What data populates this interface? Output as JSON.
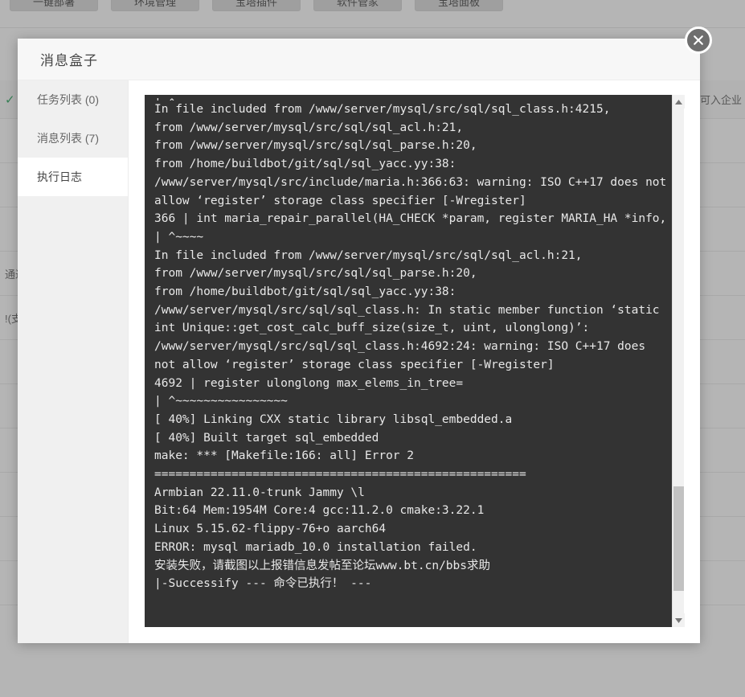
{
  "background": {
    "toolbar_buttons": [
      {
        "label": "一键部署"
      },
      {
        "label": "环境管理"
      },
      {
        "label": "宝塔插件"
      },
      {
        "label": "软件管家"
      },
      {
        "label": "宝塔面板"
      }
    ],
    "table_rows": [
      {
        "left": "✓",
        "right": "可入企业"
      },
      {
        "left": "",
        "right": ""
      },
      {
        "left": "",
        "right": ""
      },
      {
        "left": "",
        "right": ""
      },
      {
        "left": "通过",
        "right": ""
      },
      {
        "left": "!(支",
        "right": ""
      },
      {
        "left": "",
        "right": ""
      },
      {
        "left": "",
        "right": ""
      },
      {
        "left": "",
        "right": ""
      },
      {
        "left": "",
        "right": ""
      },
      {
        "left": "",
        "right": ""
      },
      {
        "left": "",
        "right": ""
      }
    ]
  },
  "modal": {
    "title": "消息盒子",
    "close_icon": "close-icon",
    "tabs": [
      {
        "label": "任务列表 (0)",
        "active": false
      },
      {
        "label": "消息列表 (7)",
        "active": false
      },
      {
        "label": "执行日志",
        "active": true
      }
    ],
    "log": {
      "clipped_top_line": "| ^~~~~~~~~~~~~~~~~~~",
      "lines": [
        "In file included from /www/server/mysql/src/sql/sql_class.h:4215,",
        "from /www/server/mysql/src/sql/sql_acl.h:21,",
        "from /www/server/mysql/src/sql/sql_parse.h:20,",
        "from /home/buildbot/git/sql/sql_yacc.yy:38:",
        "/www/server/mysql/src/include/maria.h:366:63: warning: ISO C++17 does not allow ‘register’ storage class specifier [-Wregister]",
        "366 | int maria_repair_parallel(HA_CHECK *param, register MARIA_HA *info,",
        "| ^~~~~",
        "In file included from /www/server/mysql/src/sql/sql_acl.h:21,",
        "from /www/server/mysql/src/sql/sql_parse.h:20,",
        "from /home/buildbot/git/sql/sql_yacc.yy:38:",
        "/www/server/mysql/src/sql/sql_class.h: In static member function ‘static int Unique::get_cost_calc_buff_size(size_t, uint, ulonglong)’:",
        "/www/server/mysql/src/sql/sql_class.h:4692:24: warning: ISO C++17 does not allow ‘register’ storage class specifier [-Wregister]",
        "4692 | register ulonglong max_elems_in_tree=",
        "| ^~~~~~~~~~~~~~~~~",
        "[ 40%] Linking CXX static library libsql_embedded.a",
        "[ 40%] Built target sql_embedded",
        "make: *** [Makefile:166: all] Error 2",
        "=====================================================",
        "Armbian 22.11.0-trunk Jammy \\l",
        "Bit:64 Mem:1954M Core:4 gcc:11.2.0 cmake:3.22.1",
        "Linux 5.15.62-flippy-76+o aarch64",
        "ERROR: mysql mariadb_10.0 installation failed.",
        "安装失败，请截图以上报错信息发帖至论坛www.bt.cn/bbs求助",
        "|-Successify --- 命令已执行！ ---"
      ]
    },
    "scrollbar": {
      "up_arrow": "chevron-up-icon",
      "down_arrow": "chevron-down-icon"
    }
  },
  "colors": {
    "terminal_bg": "#333333",
    "terminal_fg": "#e8e8e8",
    "modal_bg": "#ffffff",
    "tab_active_bg": "#ffffff",
    "tab_inactive_bg": "#f0f0f0",
    "close_btn_bg": "#6e6e6e"
  }
}
